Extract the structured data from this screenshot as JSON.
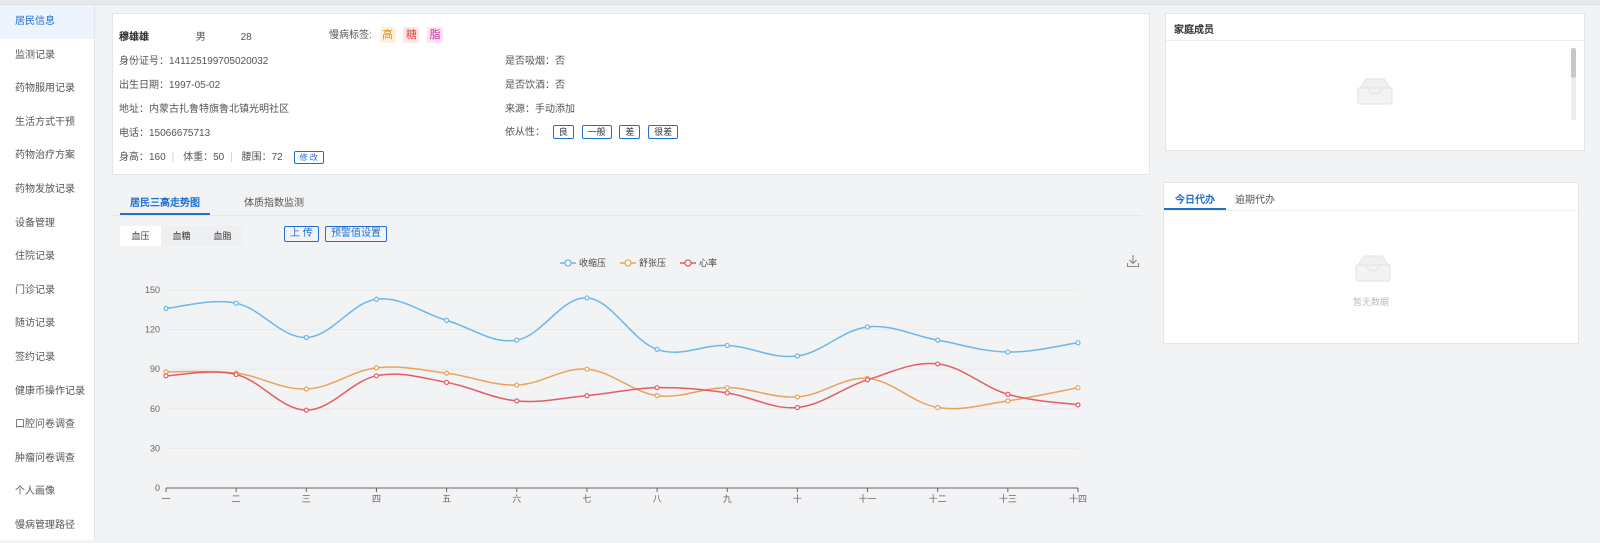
{
  "sidebar": {
    "items": [
      {
        "label": "居民信息",
        "active": true
      },
      {
        "label": "监测记录"
      },
      {
        "label": "药物服用记录"
      },
      {
        "label": "生活方式干预"
      },
      {
        "label": "药物治疗方案"
      },
      {
        "label": "药物发放记录"
      },
      {
        "label": "设备管理"
      },
      {
        "label": "住院记录"
      },
      {
        "label": "门诊记录"
      },
      {
        "label": "随访记录"
      },
      {
        "label": "签约记录"
      },
      {
        "label": "健康币操作记录"
      },
      {
        "label": "口腔问卷调查"
      },
      {
        "label": "肿瘤问卷调查"
      },
      {
        "label": "个人画像"
      },
      {
        "label": "慢病管理路径"
      }
    ]
  },
  "resident": {
    "name": "穆雄雄",
    "gender": "男",
    "age": "28",
    "tags_label": "慢病标签:",
    "tags": [
      "高",
      "糖",
      "脂"
    ],
    "id_card": "身份证号：141125199705020032",
    "birth": "出生日期：1997-05-02",
    "address": "地址：内蒙古扎鲁特旗鲁北镇光明社区",
    "phone": "电话：15066675713",
    "smoke": "是否吸烟：否",
    "drink": "是否饮酒：否",
    "source": "来源：手动添加",
    "adherence_label": "依从性：",
    "adherence_options": [
      "良",
      "一般",
      "差",
      "很差"
    ],
    "height": "身高：160",
    "weight": "体重：50",
    "waist": "腰围：72",
    "edit_label": "修 改"
  },
  "family": {
    "title": "家庭成员"
  },
  "todo": {
    "tabs": [
      "今日代办",
      "逾期代办"
    ],
    "empty_text": "暂无数据"
  },
  "chart_panel": {
    "tabs": [
      "居民三高走势图",
      "体质指数监测"
    ],
    "segments": [
      "血压",
      "血糖",
      "血脂"
    ],
    "upload_label": "上 传",
    "alert_label": "预警值设置"
  },
  "chart_data": {
    "type": "line",
    "categories": [
      "一",
      "二",
      "三",
      "四",
      "五",
      "六",
      "七",
      "八",
      "九",
      "十",
      "十一",
      "十二",
      "十三",
      "十四"
    ],
    "ylim": [
      0,
      150
    ],
    "yticks": [
      0,
      30,
      60,
      90,
      120,
      150
    ],
    "grid": true,
    "legend": "top-center",
    "smooth": true,
    "series": [
      {
        "name": "收缩压",
        "color": "#6cb7e6",
        "values": [
          136,
          140,
          114,
          143,
          127,
          112,
          144,
          105,
          108,
          100,
          122,
          112,
          103,
          110
        ]
      },
      {
        "name": "舒张压",
        "color": "#eba25a",
        "values": [
          88,
          87,
          75,
          91,
          87,
          78,
          90,
          70,
          76,
          69,
          83,
          61,
          66,
          76
        ]
      },
      {
        "name": "心率",
        "color": "#e45d65",
        "values": [
          85,
          86,
          59,
          85,
          80,
          66,
          70,
          76,
          72,
          61,
          82,
          94,
          71,
          63
        ]
      }
    ]
  }
}
